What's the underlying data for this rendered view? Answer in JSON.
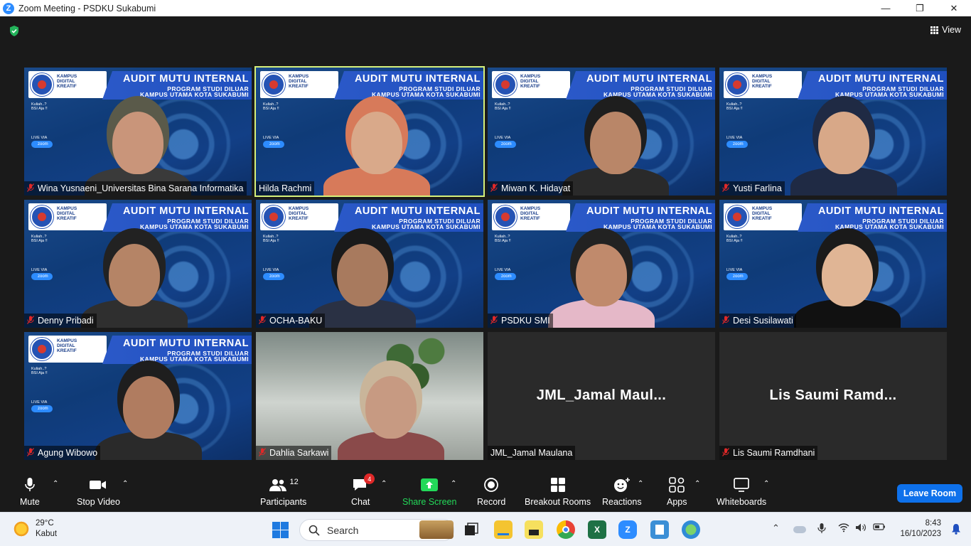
{
  "window": {
    "title": "Zoom Meeting - PSDKU Sukabumi",
    "minimize": "—",
    "maximize": "❐",
    "close": "✕",
    "logo_letter": "Z"
  },
  "meeting": {
    "view_label": "View",
    "background_text": {
      "title_line": "AUDIT MUTU INTERNAL",
      "line2": "PROGRAM STUDI DILUAR",
      "line3": "KAMPUS UTAMA KOTA SUKABUMI",
      "kampus": "KAMPUS\nDIGITAL\nKREATIF",
      "universitas": "UNIVERSITAS",
      "kuliah": "Kuliah..?\nBSI Aja !!",
      "live_via": "LIVE VIA",
      "zoom_chip": "zoom"
    },
    "participants": [
      {
        "name": "Wina Yusnaeni_Universitas Bina Sarana Informatika",
        "muted": true,
        "active": false,
        "video": true
      },
      {
        "name": "Hilda Rachmi",
        "muted": false,
        "active": true,
        "video": true
      },
      {
        "name": "Miwan K. Hidayat",
        "muted": true,
        "active": false,
        "video": true
      },
      {
        "name": "Yusti Farlina",
        "muted": true,
        "active": false,
        "video": true
      },
      {
        "name": "Denny Pribadi",
        "muted": true,
        "active": false,
        "video": true
      },
      {
        "name": "OCHA-BAKU",
        "muted": true,
        "active": false,
        "video": true
      },
      {
        "name": "PSDKU SMI",
        "muted": true,
        "active": false,
        "video": true
      },
      {
        "name": "Desi Susilawati",
        "muted": true,
        "active": false,
        "video": true
      },
      {
        "name": "Agung Wibowo",
        "muted": true,
        "active": false,
        "video": true
      },
      {
        "name": "Dahlia Sarkawi",
        "muted": true,
        "active": false,
        "video": true
      },
      {
        "name": "JML_Jamal Maulana",
        "display_name": "JML_Jamal  Maul...",
        "muted": false,
        "active": false,
        "video": false
      },
      {
        "name": "Lis Saumi Ramdhani",
        "display_name": "Lis  Saumi  Ramd...",
        "muted": true,
        "active": false,
        "video": false
      }
    ],
    "accent_colors": {
      "active_border": "#d6f07a",
      "muted_icon": "#e02828",
      "leave": "#0e71eb",
      "share": "#23d959"
    }
  },
  "toolbar": {
    "mute": "Mute",
    "stop_video": "Stop Video",
    "participants": "Participants",
    "participants_count": "12",
    "chat": "Chat",
    "chat_badge": "4",
    "share_screen": "Share Screen",
    "record": "Record",
    "breakout_rooms": "Breakout Rooms",
    "reactions": "Reactions",
    "apps": "Apps",
    "whiteboards": "Whiteboards",
    "leave_room": "Leave Room"
  },
  "taskbar": {
    "temperature": "29°C",
    "weather": "Kabut",
    "search_placeholder": "Search",
    "time": "8:43",
    "date": "16/10/2023"
  }
}
